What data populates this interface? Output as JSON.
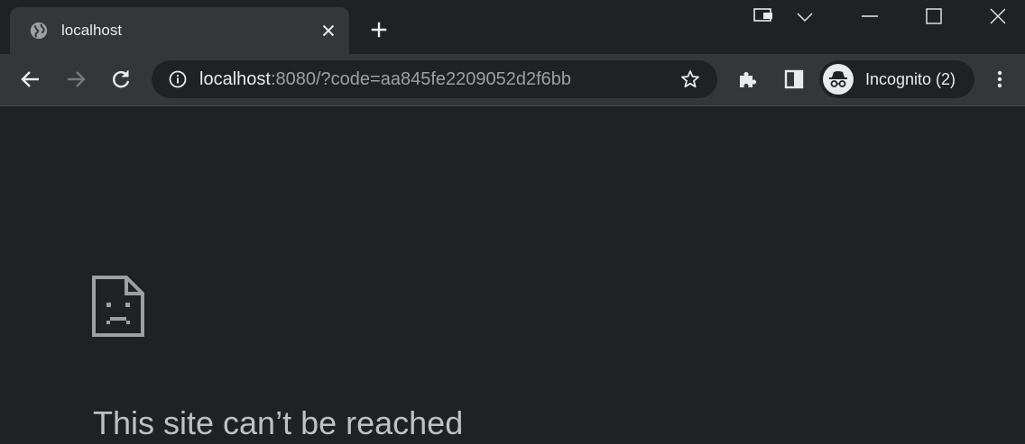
{
  "tab": {
    "title": "localhost",
    "favicon": "globe-icon",
    "close_icon": "close-icon"
  },
  "new_tab_icon": "plus-icon",
  "window_controls": {
    "icons": [
      "tab-search-icon",
      "chevron-down-icon",
      "minimize-icon",
      "maximize-icon",
      "close-window-icon"
    ]
  },
  "toolbar": {
    "back_icon": "back-arrow-icon",
    "forward_icon": "forward-arrow-icon",
    "reload_icon": "reload-icon",
    "extensions_icon": "puzzle-icon",
    "side_panel_icon": "side-panel-icon",
    "menu_icon": "kebab-menu-icon"
  },
  "omnibox": {
    "info_icon": "info-icon",
    "url_host": "localhost",
    "url_rest": ":8080/?code=aa845fe2209052d2f6bb",
    "bookmark_icon": "star-icon"
  },
  "profile": {
    "label": "Incognito (2)",
    "avatar_icon": "incognito-icon"
  },
  "error": {
    "icon": "sad-document-icon",
    "title": "This site can’t be reached"
  },
  "colors": {
    "page_bg": "#202124",
    "toolbar_bg": "#35363a",
    "text": "#e8eaed",
    "muted_text": "#9aa0a6",
    "error_title": "#bdc1c6"
  }
}
